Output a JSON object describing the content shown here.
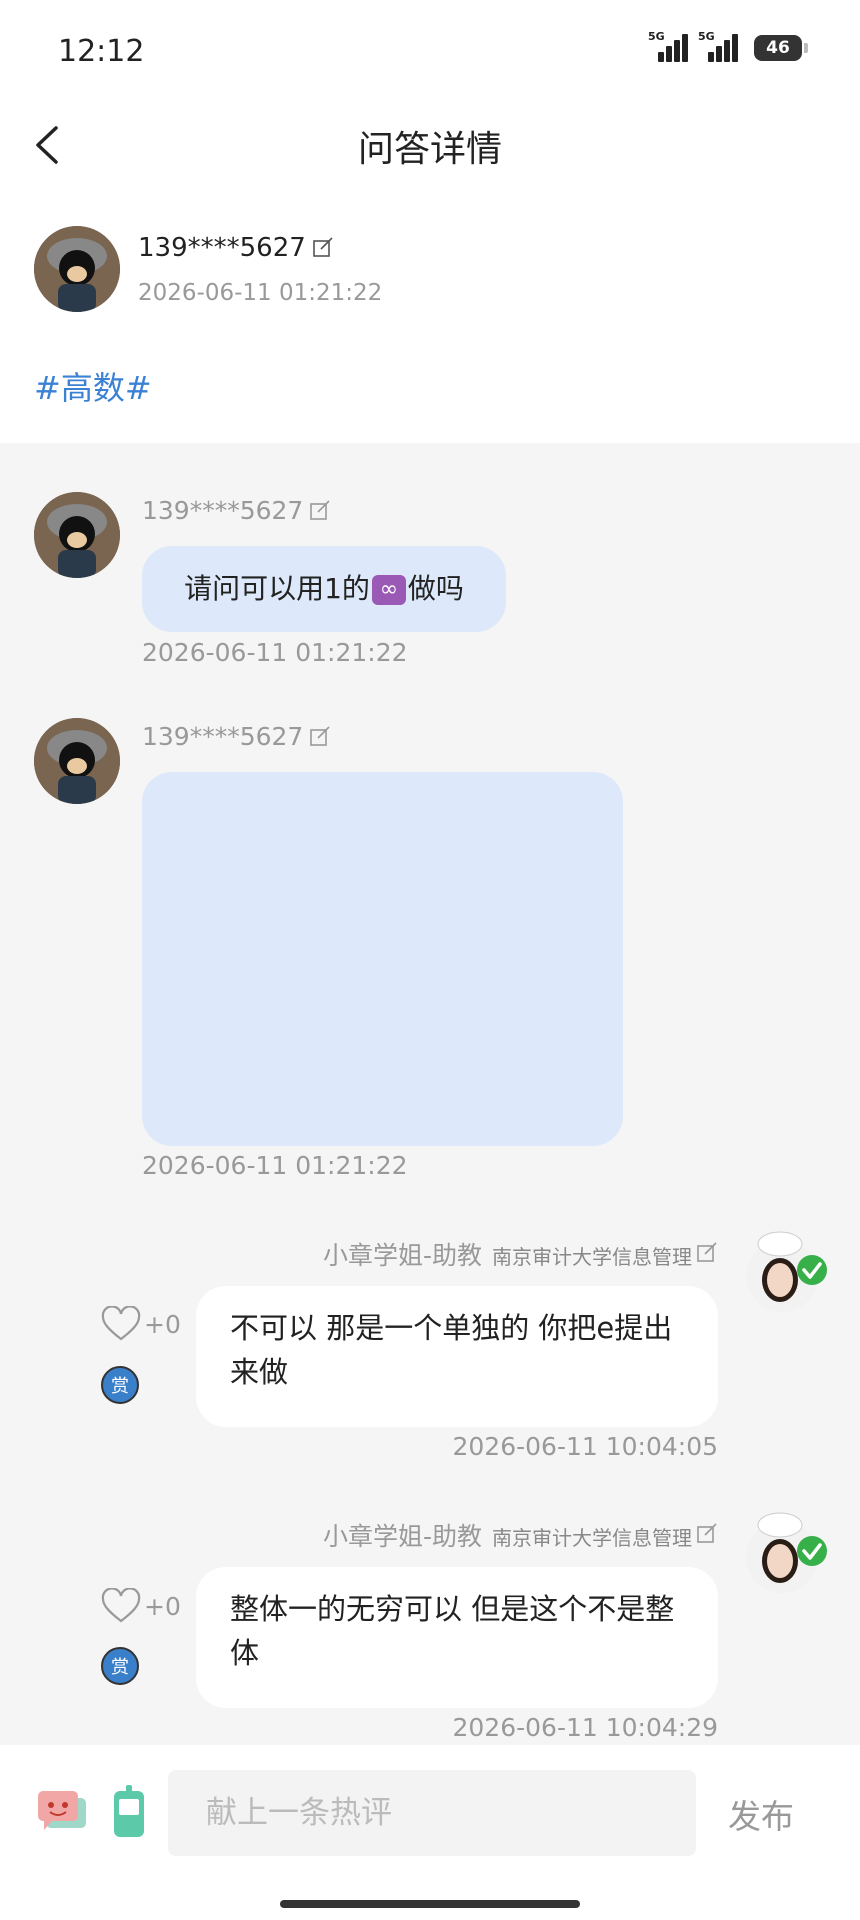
{
  "status": {
    "time": "12:12",
    "net1": "5G",
    "net2": "5G",
    "battery": "46"
  },
  "nav": {
    "title": "问答详情"
  },
  "post": {
    "username": "139****5627",
    "time": "2026-06-11 01:21:22",
    "topic": "#高数#"
  },
  "messages": [
    {
      "username": "139****5627",
      "text_before": "请问可以用1的",
      "emoji": "∞",
      "text_after": "做吗",
      "time": "2026-06-11 01:21:22"
    },
    {
      "username": "139****5627",
      "time": "2026-06-11 01:21:22"
    }
  ],
  "answers": [
    {
      "name": "小章学姐-助教",
      "school": "南京审计大学信息管理",
      "text": "不可以 那是一个单独的 你把e提出来做",
      "likes": "+0",
      "reward": "赏",
      "time": "2026-06-11 10:04:05"
    },
    {
      "name": "小章学姐-助教",
      "school": "南京审计大学信息管理",
      "text": "整体一的无穷可以 但是这个不是整体",
      "likes": "+0",
      "reward": "赏",
      "time": "2026-06-11 10:04:29"
    }
  ],
  "composer": {
    "placeholder": "献上一条热评",
    "publish": "发布"
  },
  "colors": {
    "accent": "#3b82d4",
    "bubble_user": "#dde9fa",
    "bubble_ta": "#ffffff",
    "background": "#f5f5f5"
  },
  "icons": [
    "back-arrow-icon",
    "edit-icon",
    "heart-icon",
    "reward-badge-icon",
    "chat-bubble-icon",
    "phone-icon",
    "verified-check-icon"
  ]
}
